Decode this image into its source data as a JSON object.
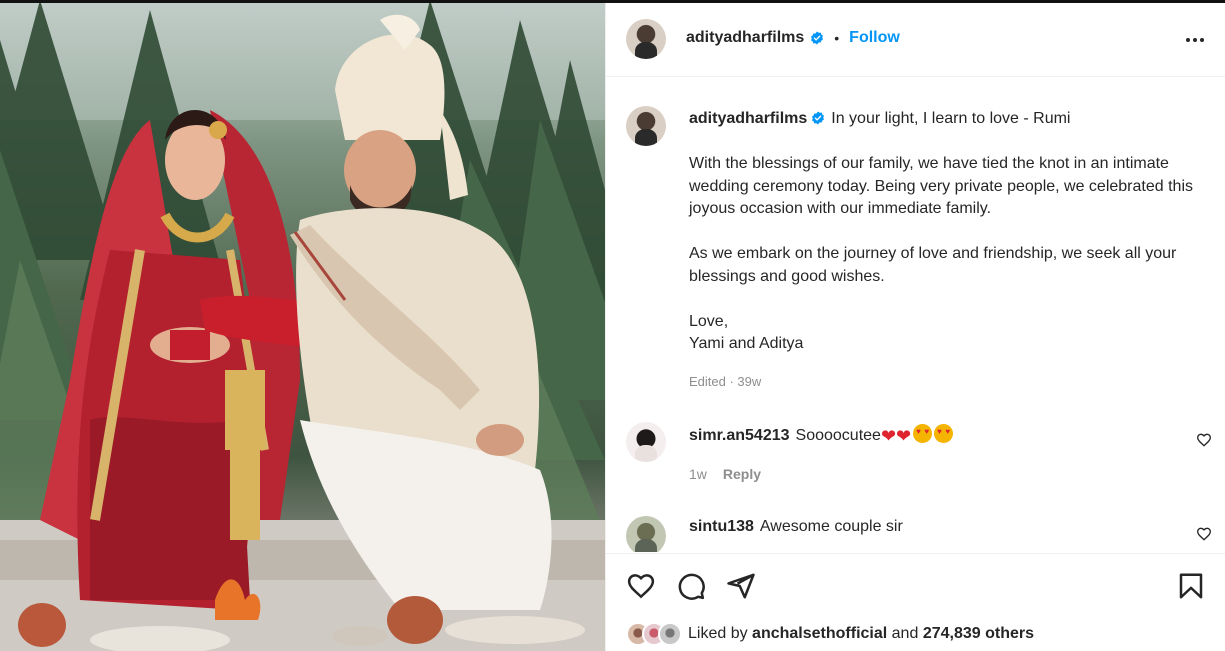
{
  "post": {
    "username": "adityadharfilms",
    "follow_label": "Follow",
    "separator": "•"
  },
  "caption": {
    "username": "adityadharfilms",
    "first_line": "In your light, I learn to love - Rumi",
    "paragraph_2": "With the blessings of our family, we have tied the knot in an intimate wedding ceremony today. Being very private people, we celebrated this joyous occasion with our immediate family.",
    "paragraph_3": "As we embark on the journey of love and friendship, we seek all your blessings and good wishes.",
    "signoff_1": "Love,",
    "signoff_2": "Yami and Aditya",
    "meta": "Edited · 39w"
  },
  "comments": [
    {
      "username": "simr.an54213",
      "text": "Soooocutee",
      "time": "1w",
      "reply_label": "Reply"
    },
    {
      "username": "sintu138",
      "text": "Awesome couple sir"
    }
  ],
  "likes": {
    "prefix": "Liked by",
    "user": "anchalsethofficial",
    "middle": "and",
    "others": "274,839 others"
  },
  "colors": {
    "accent": "#0095f6",
    "text": "#262626",
    "muted": "#8e8e8e",
    "heart": "#e0242f"
  },
  "icons": [
    "verified-icon",
    "more-icon",
    "heart-icon",
    "comment-icon",
    "share-icon",
    "bookmark-icon"
  ]
}
